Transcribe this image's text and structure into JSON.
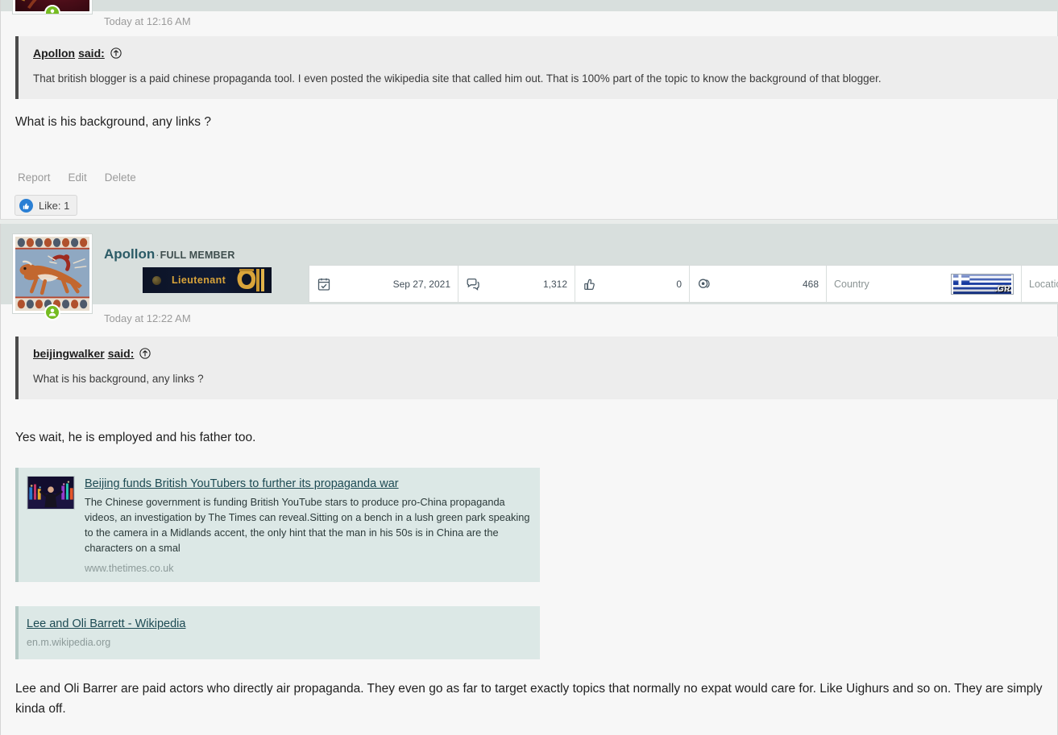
{
  "posts": [
    {
      "id": "post-beijingwalker",
      "author_visible": false,
      "timestamp": "Today at 12:16 AM",
      "quote": {
        "author": "Apollon",
        "said_suffix": "said:",
        "jump_icon": "jump-to-post-icon",
        "text": "That british blogger is a paid chinese propaganda tool. I even posted the wikipedia site that called him out. That is 100% part of the topic to know the background of that blogger."
      },
      "body": "What is his background, any links ?",
      "actions": [
        "Report",
        "Edit",
        "Delete"
      ],
      "like": {
        "icon": "thumbs-up-icon",
        "label": "Like: 1"
      },
      "avatar": {
        "name": "user-avatar",
        "online_badge_icon": "online-status-icon"
      }
    },
    {
      "id": "post-apollon",
      "author_visible": true,
      "username": "Apollon",
      "separator": "·",
      "user_title": "FULL MEMBER",
      "rank": {
        "label": "Lieutenant",
        "insignia_icon": "rank-insignia-icon"
      },
      "timestamp": "Today at 12:22 AM",
      "stats": [
        {
          "icon": "calendar-joined-icon",
          "name": "joined-date",
          "value": "Sep 27, 2021"
        },
        {
          "icon": "messages-icon",
          "name": "messages-count",
          "value": "1,312"
        },
        {
          "icon": "thumbs-up-outline-icon",
          "name": "likes-count",
          "value": "0"
        },
        {
          "icon": "reactions-icon",
          "name": "reactions-count",
          "value": "468"
        },
        {
          "icon": "",
          "name": "country-field",
          "label": "Country",
          "flag": "greece-flag-badge",
          "flag_text": ".GR"
        },
        {
          "icon": "",
          "name": "location-field",
          "label": "Location",
          "value": ""
        }
      ],
      "quote": {
        "author": "beijingwalker",
        "said_suffix": "said:",
        "jump_icon": "jump-to-post-icon",
        "text": "What is his background, any links ?"
      },
      "body_intro": "Yes wait, he is employed and his father too.",
      "link_cards": [
        {
          "name": "link-preview-thetimes",
          "thumb": "article-thumbnail",
          "title": "Beijing funds British YouTubers to further its propaganda war",
          "description": "The Chinese government is funding British YouTube stars to produce pro-China propaganda videos, an investigation by The Times can reveal.Sitting on a bench in a lush green park speaking to the camera in a Midlands accent, the only hint that the man in his 50s is in China are the characters on a smal",
          "host": "www.thetimes.co.uk"
        },
        {
          "name": "link-preview-wikipedia",
          "thumb": "",
          "title": "Lee and Oli Barrett - Wikipedia",
          "description": "",
          "host": "en.m.wikipedia.org"
        }
      ],
      "body_outro": "Lee and Oli Barrer are paid actors who directly air propaganda. They even go as far to target exactly topics that normally no expat would care for. Like Uighurs and so on. They are simply kinda off."
    }
  ],
  "colors": {
    "header_band": "#d8dfdd",
    "post_bg": "#f7f7f7",
    "quote_bg": "#ededed",
    "quote_border": "#4b4b4b",
    "link_card_bg": "#dce8e6",
    "username": "#2b5b66",
    "link_title": "#1d4a53",
    "like_blue": "#2a7fd4",
    "online_green": "#76bc21",
    "rank_gold": "#d9a43a"
  }
}
